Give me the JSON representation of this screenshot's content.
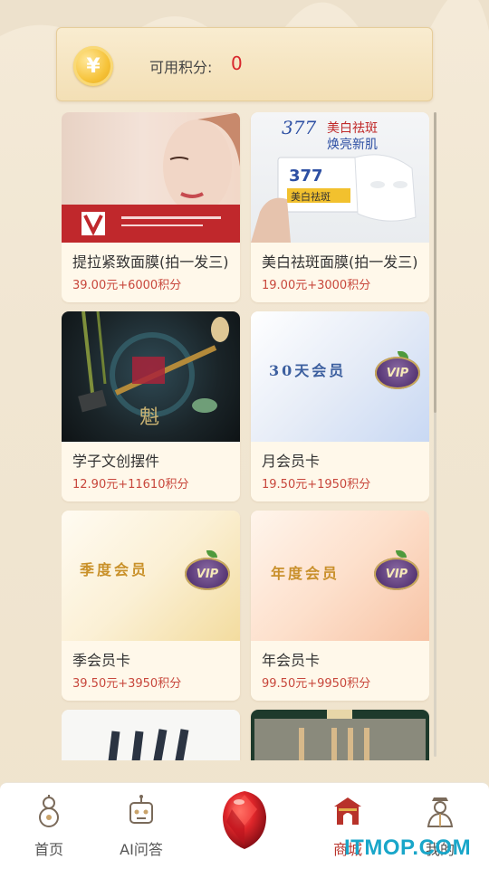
{
  "points": {
    "label": "可用积分:",
    "value": "0",
    "coin_symbol": "¥"
  },
  "products": [
    {
      "name": "提拉紧致面膜(拍一发三)",
      "price": "39.00元+6000积分",
      "image": "face-mask-model"
    },
    {
      "name": "美白祛斑面膜(拍一发三)",
      "price": "19.00元+3000积分",
      "image": "whitening-mask",
      "image_text": {
        "headline": "美白祛斑",
        "subline": "焕亮新肌",
        "number": "377"
      }
    },
    {
      "name": "学子文创摆件",
      "price": "12.90元+11610积分",
      "image": "cultural-ornament",
      "image_text": {
        "char": "魁"
      }
    },
    {
      "name": "月会员卡",
      "price": "19.50元+1950积分",
      "image": "vip-card",
      "image_text": {
        "title": "30天会员",
        "badge": "VIP"
      }
    },
    {
      "name": "季会员卡",
      "price": "39.50元+3950积分",
      "image": "vip-card",
      "image_text": {
        "title": "季度会员",
        "badge": "VIP"
      }
    },
    {
      "name": "年会员卡",
      "price": "99.50元+9950积分",
      "image": "vip-card",
      "image_text": {
        "title": "年度会员",
        "badge": "VIP"
      }
    },
    {
      "name": "",
      "price": "",
      "image": "pens"
    },
    {
      "name": "",
      "price": "",
      "image": "wooden-pens"
    }
  ],
  "tabs": [
    {
      "label": "首页",
      "icon": "gourd-icon"
    },
    {
      "label": "AI问答",
      "icon": "robot-icon"
    },
    {
      "label": "",
      "icon": "ruby-gem-icon"
    },
    {
      "label": "商城",
      "icon": "gate-icon",
      "active": true
    },
    {
      "label": "我的",
      "icon": "scholar-icon"
    }
  ],
  "watermark": "ITMOP.COM",
  "colors": {
    "accent": "#d8262c",
    "price": "#c8473c",
    "background": "#f2e7d3"
  }
}
